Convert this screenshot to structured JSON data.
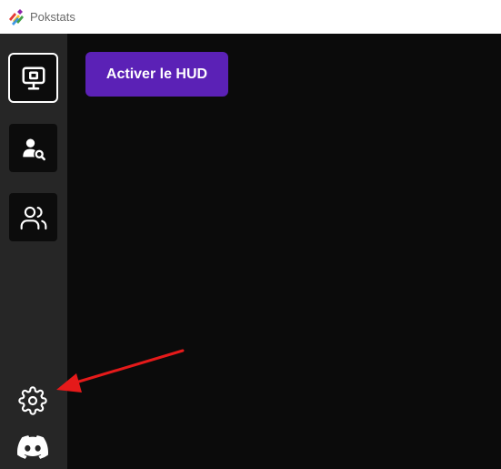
{
  "window": {
    "title": "Pokstats"
  },
  "sidebar": {
    "items": [
      {
        "id": "hud",
        "icon": "monitor-icon",
        "active": true
      },
      {
        "id": "player-search",
        "icon": "user-search-icon",
        "active": false
      },
      {
        "id": "players",
        "icon": "users-icon",
        "active": false
      }
    ],
    "bottom": [
      {
        "id": "settings",
        "icon": "gear-icon"
      },
      {
        "id": "discord",
        "icon": "discord-icon"
      }
    ]
  },
  "main": {
    "hud_button_label": "Activer le HUD"
  },
  "colors": {
    "accent": "#5b21b6",
    "sidebar_bg": "#262626",
    "main_bg": "#0b0b0b",
    "annotation_arrow": "#e51a1a"
  }
}
